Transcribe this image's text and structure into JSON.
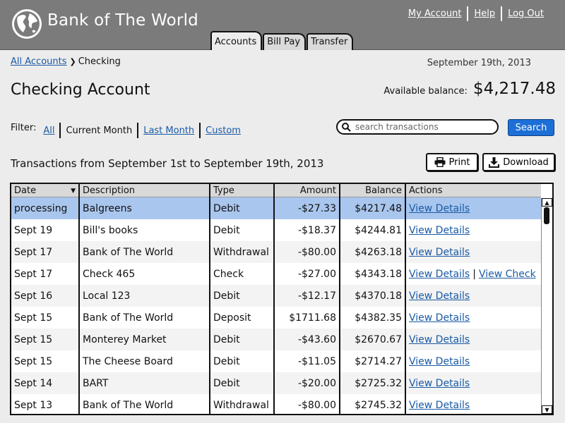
{
  "header": {
    "brand": "Bank of The World",
    "links": {
      "my_account": "My Account",
      "help": "Help",
      "log_out": "Log Out"
    },
    "tabs": [
      {
        "label": "Accounts",
        "active": true
      },
      {
        "label": "Bill Pay",
        "active": false
      },
      {
        "label": "Transfer",
        "active": false
      }
    ]
  },
  "breadcrumb": {
    "parent": "All Accounts",
    "current": "Checking"
  },
  "date": "September 19th, 2013",
  "page_title": "Checking Account",
  "balance": {
    "label": "Available balance:",
    "value": "$4,217.48"
  },
  "filter": {
    "label": "Filter:",
    "options": [
      "All",
      "Current Month",
      "Last Month",
      "Custom"
    ],
    "selected": "Current Month"
  },
  "search": {
    "placeholder": "search transactions",
    "value": "",
    "button_label": "Search"
  },
  "range_text": "Transactions from September 1st to September 19th, 2013",
  "buttons": {
    "print": "Print",
    "download": "Download"
  },
  "table": {
    "columns": [
      "Date",
      "Description",
      "Type",
      "Amount",
      "Balance",
      "Actions"
    ],
    "sort_column": "Date",
    "rows": [
      {
        "date": "processing",
        "description": "Balgreens",
        "type": "Debit",
        "amount": "-$27.33",
        "balance": "$4217.48",
        "actions": [
          "View Details"
        ],
        "selected": true
      },
      {
        "date": "Sept 19",
        "description": "Bill's books",
        "type": "Debit",
        "amount": "-$18.37",
        "balance": "$4244.81",
        "actions": [
          "View Details"
        ]
      },
      {
        "date": "Sept 17",
        "description": "Bank of The World",
        "type": "Withdrawal",
        "amount": "-$80.00",
        "balance": "$4263.18",
        "actions": [
          "View Details"
        ]
      },
      {
        "date": "Sept 17",
        "description": "Check 465",
        "type": "Check",
        "amount": "-$27.00",
        "balance": "$4343.18",
        "actions": [
          "View Details",
          "View Check"
        ]
      },
      {
        "date": "Sept 16",
        "description": "Local 123",
        "type": "Debit",
        "amount": "-$12.17",
        "balance": "$4370.18",
        "actions": [
          "View Details"
        ]
      },
      {
        "date": "Sept 15",
        "description": "Bank of The World",
        "type": "Deposit",
        "amount": "$1711.68",
        "balance": "$4382.35",
        "actions": [
          "View Details"
        ]
      },
      {
        "date": "Sept 15",
        "description": "Monterey Market",
        "type": "Debit",
        "amount": "-$43.60",
        "balance": "$2670.67",
        "actions": [
          "View Details"
        ]
      },
      {
        "date": "Sept 15",
        "description": "The Cheese Board",
        "type": "Debit",
        "amount": "-$11.05",
        "balance": "$2714.27",
        "actions": [
          "View Details"
        ]
      },
      {
        "date": "Sept 14",
        "description": "BART",
        "type": "Debit",
        "amount": "-$20.00",
        "balance": "$2725.32",
        "actions": [
          "View Details"
        ]
      },
      {
        "date": "Sept 13",
        "description": "Bank of The World",
        "type": "Withdrawal",
        "amount": "-$80.00",
        "balance": "$2745.32",
        "actions": [
          "View Details"
        ]
      }
    ]
  },
  "icons": {
    "logo": "globe-icon",
    "search": "search-icon",
    "print": "printer-icon",
    "download": "download-icon",
    "sort": "sort-down-icon",
    "scroll_up": "arrow-up-icon",
    "scroll_down": "arrow-down-icon"
  },
  "colors": {
    "header_bg": "#7b7b7b",
    "page_bg": "#ececec",
    "link": "#1a5aa5",
    "primary_button": "#1d6fd6",
    "selected_row": "#a9c6ee"
  }
}
